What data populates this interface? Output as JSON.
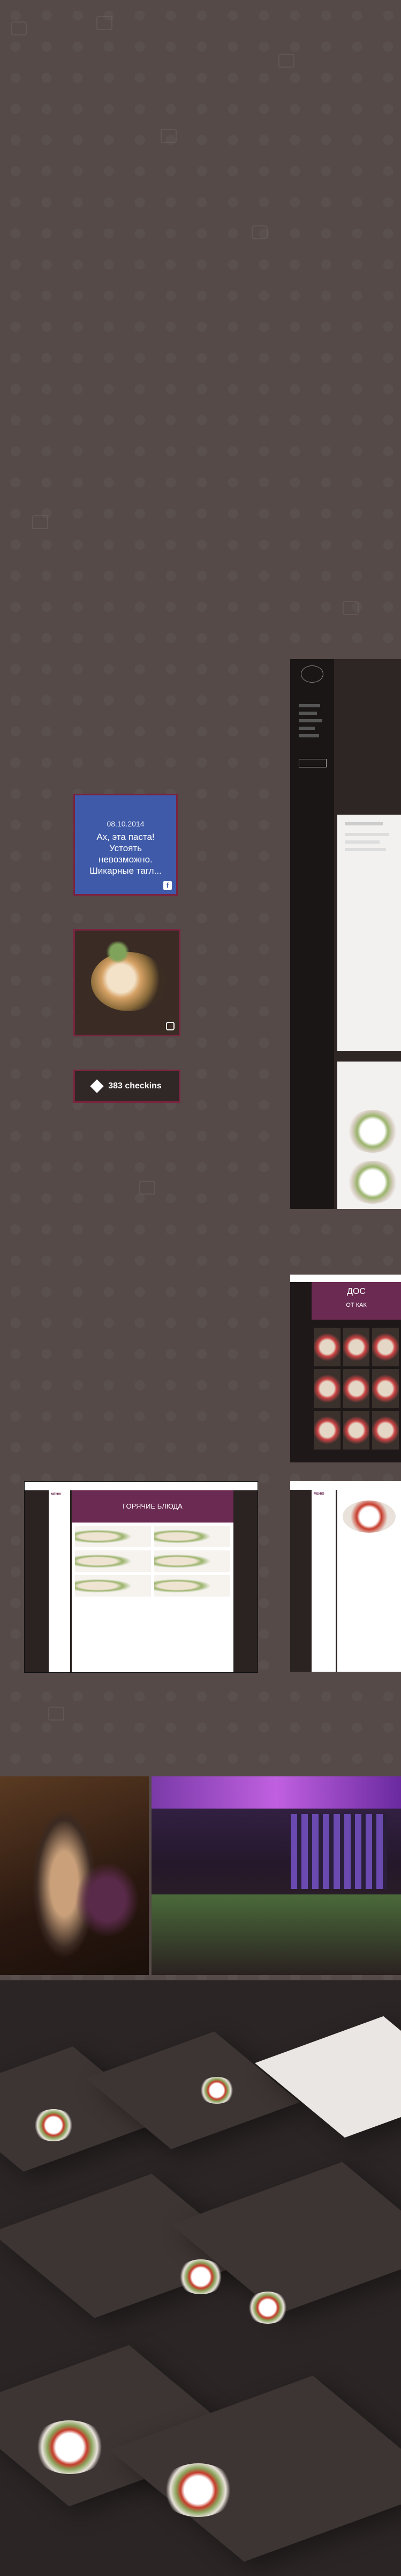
{
  "social": {
    "facebook_card": {
      "date": "08.10.2014",
      "text": "Ах, эта паста! Устоять невозможно. Шикарные тагл...",
      "icon": "facebook-icon",
      "accent": "#3f5aa8",
      "border": "#7a2340"
    },
    "instagram_card": {
      "icon": "instagram-icon"
    },
    "checkins": {
      "label": "383 checkins",
      "icon": "foursquare-icon"
    }
  },
  "mockups": {
    "purple_site": {
      "hero_text": "ДОС\nОТ КАК"
    },
    "menu_site": {
      "menu_title": "МЕНЮ",
      "band_title": "ГОРЯЧИЕ БЛЮДА"
    },
    "menu_site2": {
      "menu_title": "МЕНЮ"
    }
  },
  "colors": {
    "background": "#554a47",
    "brand": "#6b2a52"
  }
}
